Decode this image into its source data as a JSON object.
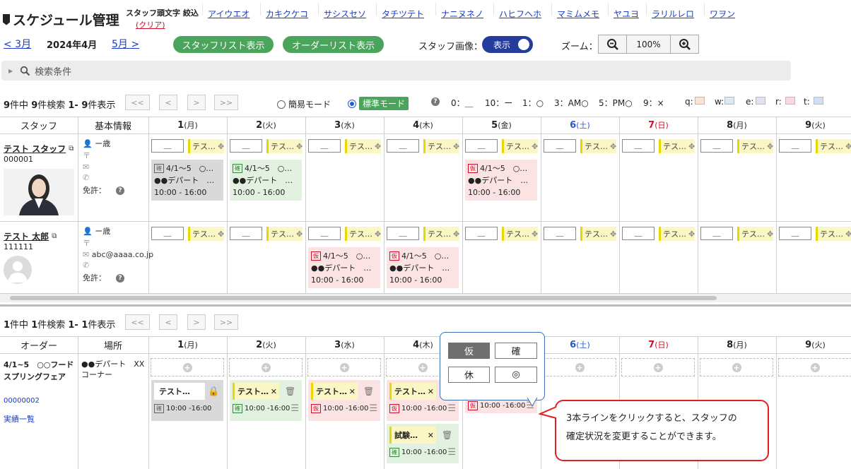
{
  "header": {
    "title": "スケジュール管理",
    "initial_filter_label": "スタッフ頭文字 絞込",
    "clear_label": "(クリア)",
    "kana_links": [
      "アイウエオ",
      "カキクケコ",
      "サシスセソ",
      "タチツテト",
      "ナニヌネノ",
      "ハヒフヘホ",
      "マミムメモ",
      "ヤユヨ",
      "ラリルレロ",
      "ワヲン"
    ]
  },
  "toolbar": {
    "prev_month": "< 3月",
    "current_month": "2024年4月",
    "next_month": "5月 >",
    "staff_list_button": "スタッフリスト表示",
    "order_list_button": "オーダーリスト表示",
    "staff_image_label": "スタッフ画像：",
    "staff_image_toggle": "表示",
    "zoom_label": "ズーム：",
    "zoom_value": "100%"
  },
  "search": {
    "label": "検索条件"
  },
  "staff_section": {
    "count": {
      "a": "9",
      "t1": "件中 ",
      "b": "9",
      "t2": "件検索 ",
      "c": "1- 9",
      "t3": "件表示"
    },
    "pager": [
      "<<",
      "<",
      ">",
      ">>"
    ],
    "mode_simple": "簡易モード",
    "mode_standard": "標準モード",
    "legend": [
      "0：＿",
      "10：ー",
      "1：○",
      "3：AM○",
      "5：PM○",
      "9：×"
    ],
    "color_legend": [
      {
        "label": "q:",
        "color": "#fde2d4"
      },
      {
        "label": "w:",
        "color": "#dbe9f7"
      },
      {
        "label": "e:",
        "color": "#e4e0f2"
      },
      {
        "label": "r:",
        "color": "#f9d9d9"
      },
      {
        "label": "t:",
        "color": "#cfe0f5"
      }
    ],
    "col_staff": "スタッフ",
    "col_info": "基本情報",
    "days": [
      {
        "d": "1",
        "w": "(月)",
        "color": "#222"
      },
      {
        "d": "2",
        "w": "(火)",
        "color": "#222"
      },
      {
        "d": "3",
        "w": "(水)",
        "color": "#222"
      },
      {
        "d": "4",
        "w": "(木)",
        "color": "#222"
      },
      {
        "d": "5",
        "w": "(金)",
        "color": "#222"
      },
      {
        "d": "6",
        "w": "(土)",
        "color": "#2459c8"
      },
      {
        "d": "7",
        "w": "(日)",
        "color": "#d0102a"
      },
      {
        "d": "8",
        "w": "(月)",
        "color": "#222"
      },
      {
        "d": "9",
        "w": "(火)",
        "color": "#222"
      }
    ],
    "blank_cell": "＿",
    "tag_text": "テス…",
    "staff": [
      {
        "name": "テスト スタッフ",
        "id": "000001",
        "age": "ー歳",
        "email": "",
        "license": "免許：",
        "has_photo": true,
        "cards": [
          {
            "day": 0,
            "style": "gray",
            "badge": "確",
            "l1": "4/1～5　○…",
            "l2": "●●デパート　…",
            "l3": "10:00 - 16:00"
          },
          {
            "day": 1,
            "style": "green",
            "badge": "確",
            "l1": "4/1～5　○…",
            "l2": "●●デパート　…",
            "l3": "10:00 - 16:00"
          },
          {
            "day": 4,
            "style": "pink",
            "badge": "仮",
            "l1": "4/1～5　○…",
            "l2": "●●デパート　…",
            "l3": "10:00 - 16:00"
          }
        ]
      },
      {
        "name": "テスト 太郎",
        "id": "111111",
        "age": "ー歳",
        "email": "abc@aaaa.co.jp",
        "license": "免許：",
        "has_photo": false,
        "cards": [
          {
            "day": 2,
            "style": "pink",
            "badge": "仮",
            "l1": "4/1～5　○…",
            "l2": "●●デパート　…",
            "l3": "10:00 - 16:00"
          },
          {
            "day": 3,
            "style": "pink",
            "badge": "仮",
            "l1": "4/1～5　○…",
            "l2": "●●デパート　…",
            "l3": "10:00 - 16:00"
          }
        ]
      }
    ]
  },
  "order_section": {
    "count": {
      "a": "1",
      "t1": "件中 ",
      "b": "1",
      "t2": "件検索 ",
      "c": "1- 1",
      "t3": "件表示"
    },
    "col_order": "オーダー",
    "col_place": "場所",
    "order_name": "4/1~5　○○フード　スプリングフェア",
    "order_no": "00000002",
    "results_link": "実績一覧",
    "place": "●●デパート　XXコーナー",
    "cards": [
      {
        "day": 0,
        "style": "gray",
        "name": "テスト…",
        "tag": false,
        "action": "lock",
        "badge": "確",
        "time": "10:00 -16:00"
      },
      {
        "day": 1,
        "style": "green",
        "name": "テスト…",
        "tag": true,
        "action": "del",
        "badge": "確",
        "time": "10:00 -16:00"
      },
      {
        "day": 2,
        "style": "pink",
        "name": "テスト…",
        "tag": true,
        "action": "del",
        "badge": "仮",
        "time": "10:00 -16:00"
      },
      {
        "day": 3,
        "style": "pink",
        "name": "テスト…",
        "tag": true,
        "action": "del",
        "badge": "仮",
        "time": "10:00 -16:00"
      },
      {
        "day": 3,
        "style": "green",
        "name": "試験…",
        "tag": true,
        "action": "del",
        "badge": "確",
        "time": "10:00 -16:00",
        "row": 1
      },
      {
        "day": 4,
        "style": "pink",
        "name": "",
        "tag": false,
        "action": "none",
        "badge": "仮",
        "time": "10:00 -16:00",
        "partial": true
      }
    ]
  },
  "popup": {
    "b1": "仮",
    "b2": "確",
    "b3": "休",
    "b4": "◎"
  },
  "callout": {
    "line1": "3本ラインをクリックすると、スタッフの",
    "line2": "確定状況を変更することができます。"
  }
}
